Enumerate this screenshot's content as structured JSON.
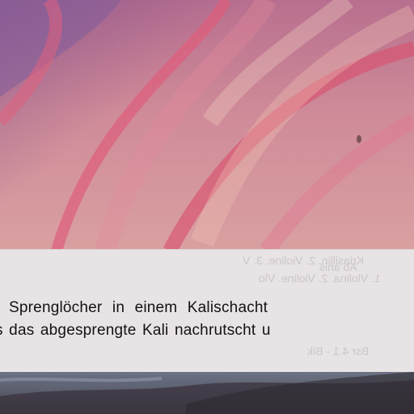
{
  "caption": {
    "line1": "r Sprenglöcher in einem Kalischacht",
    "line2": "s das abgesprengte Kali nachrutscht u"
  }
}
